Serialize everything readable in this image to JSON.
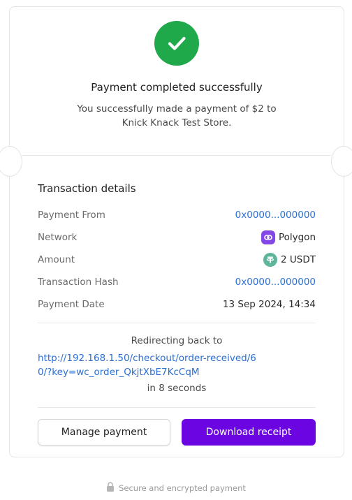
{
  "header": {
    "status_title": "Payment completed successfully",
    "status_message": "You successfully made a payment of $2 to Knick Knack Test Store."
  },
  "details": {
    "title": "Transaction details",
    "rows": [
      {
        "label": "Payment From",
        "value": "0x0000...000000"
      },
      {
        "label": "Network",
        "value": "Polygon",
        "icon": "polygon-icon"
      },
      {
        "label": "Amount",
        "value": "2 USDT",
        "icon": "tether-icon"
      },
      {
        "label": "Transaction Hash",
        "value": "0x0000...000000"
      },
      {
        "label": "Payment Date",
        "value": "13 Sep 2024, 14:34"
      }
    ]
  },
  "redirect": {
    "label": "Redirecting back to",
    "url": "http://192.168.1.50/checkout/order-received/60/?key=wc_order_QkjtXbE7KcCqM",
    "countdown": "in 8 seconds"
  },
  "actions": {
    "manage_label": "Manage payment",
    "download_label": "Download receipt"
  },
  "footer": {
    "security_text": "Secure and encrypted payment"
  },
  "colors": {
    "success": "#20a94b",
    "primary": "#6b06e2",
    "link": "#2b6fd6",
    "polygon": "#8247e5",
    "tether": "#5fb49c"
  }
}
